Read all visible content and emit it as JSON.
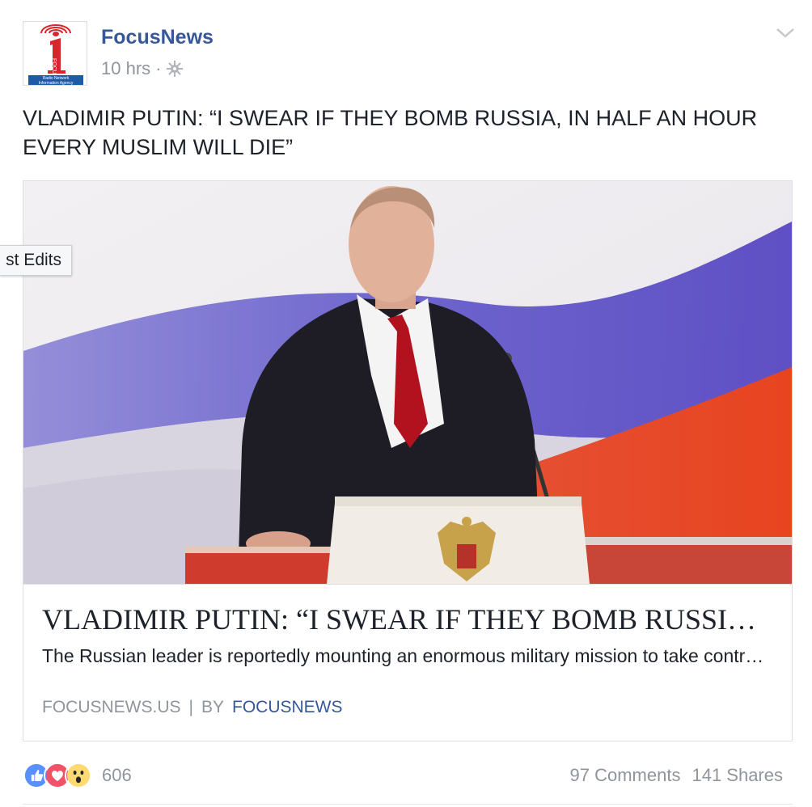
{
  "post": {
    "page_name": "FocusNews",
    "time": "10 hrs",
    "separator": "·",
    "text": "VLADIMIR PUTIN: “I SWEAR IF THEY BOMB RUSSIA, IN HALF AN HOUR EVERY MUSLIM WILL DIE”",
    "avatar_icon": "focus-radio-logo-icon",
    "privacy_icon": "globe-icon"
  },
  "avatar_logo": {
    "lines": [
      "Radio Network",
      "Information Agency"
    ],
    "brand_color": "#d9262b",
    "band_color": "#1f5aa6"
  },
  "attachment": {
    "title": "VLADIMIR PUTIN: “I SWEAR IF THEY BOMB RUSSIA, IN HALF AN HOUR EVERY MUSLIM WILL DIE”",
    "description": "The Russian leader is reportedly mounting an enormous military mission to take control of the situation",
    "source": "FOCUSNEWS.US",
    "source_separator": "|",
    "by_label": "BY",
    "author": "FOCUSNEWS"
  },
  "overlay": {
    "edits_label": "st Edits"
  },
  "footer": {
    "reaction_icons": [
      "like-icon",
      "love-icon",
      "wow-icon"
    ],
    "reaction_count": "606",
    "comments": "97 Comments",
    "shares": "141 Shares"
  },
  "colors": {
    "link_blue": "#365899",
    "meta_gray": "#90949c",
    "like_blue": "#5890ff",
    "love_red": "#f25268",
    "wow_yellow": "#ffd972"
  }
}
